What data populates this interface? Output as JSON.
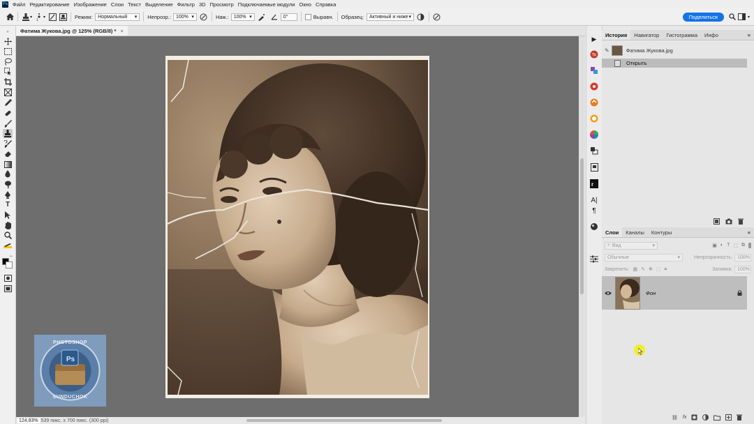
{
  "menubar": {
    "app_icon": "Ps",
    "items": [
      "Файл",
      "Редактирование",
      "Изображение",
      "Слои",
      "Текст",
      "Выделение",
      "Фильтр",
      "3D",
      "Просмотр",
      "Подключаемые модули",
      "Окно",
      "Справка"
    ]
  },
  "options": {
    "mode_label": "Режим:",
    "mode_value": "Нормальный",
    "opacity_label": "Непрозр.:",
    "opacity_value": "100%",
    "pressure_label": "Наж.:",
    "pressure_value": "100%",
    "angle_value": "0°",
    "align_label": "Выравн.",
    "sample_label": "Образец:",
    "sample_value": "Активный и ниже",
    "share_label": "Поделиться"
  },
  "document": {
    "tab_title": "Фатима Жукова.jpg @ 125% (RGB/8) *",
    "close": "×"
  },
  "status": {
    "zoom": "124,83%",
    "info": "539 пикс. x 700 пикс. (300 ppi)"
  },
  "watermark": {
    "text_top": "PHOTOSHOP",
    "text_bottom": "SUNDUCHOK",
    "badge": "Ps"
  },
  "history_panel": {
    "tabs": [
      "История",
      "Навигатор",
      "Гистограмма",
      "Инфо"
    ],
    "snapshot_label": "Фатима Жукова.jpg",
    "steps": [
      "Открыть"
    ]
  },
  "layers_panel": {
    "tabs": [
      "Слои",
      "Каналы",
      "Контуры"
    ],
    "filter_placeholder": "Вид",
    "blend_mode": "Обычные",
    "opacity_label": "Непрозрачность:",
    "opacity_value": "100%",
    "lock_label": "Закрепить:",
    "fill_label": "Заливка:",
    "fill_value": "100%",
    "layers": [
      {
        "name": "Фон",
        "visible": true,
        "locked": true
      }
    ]
  },
  "colors": {
    "accent": "#1473e6",
    "canvas_bg": "#6e6e6e",
    "cursor": "#f2ee1e"
  }
}
